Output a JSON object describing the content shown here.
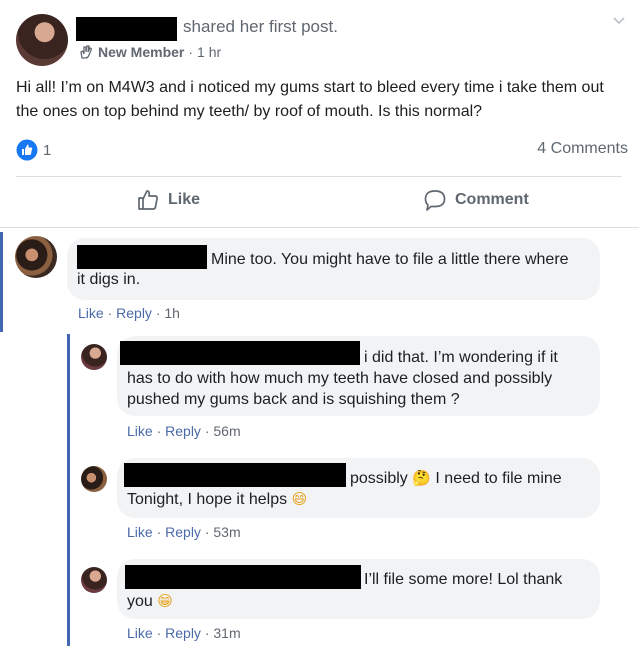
{
  "post": {
    "shared_text": "shared her first post.",
    "badge_label": "New Member",
    "time": "1 hr",
    "body": "Hi all! I’m on M4W3 and i noticed my gums start to bleed every time i take them out the ones on top behind my teeth/ by roof of mouth. Is this normal?",
    "reaction_count": "1",
    "comments_count": "4 Comments"
  },
  "actions": {
    "like": "Like",
    "comment": "Comment"
  },
  "comments": [
    {
      "line1": "Mine too. You might have to file a little there where",
      "line2": "it digs in.",
      "like": "Like",
      "reply": "Reply",
      "time": "1h"
    },
    {
      "line1": "i did that. I’m wondering if it",
      "line2": "has to do with how much my teeth have closed and possibly",
      "line3": "pushed my gums back and is squishing them ?",
      "like": "Like",
      "reply": "Reply",
      "time": "56m"
    },
    {
      "line1a": "possibly",
      "line1b": "I need to file mine",
      "line2": "Tonight, I hope it helps",
      "like": "Like",
      "reply": "Reply",
      "time": "53m"
    },
    {
      "line1": "I’ll file some more! Lol thank",
      "line2": "you",
      "like": "Like",
      "reply": "Reply",
      "time": "31m"
    }
  ]
}
